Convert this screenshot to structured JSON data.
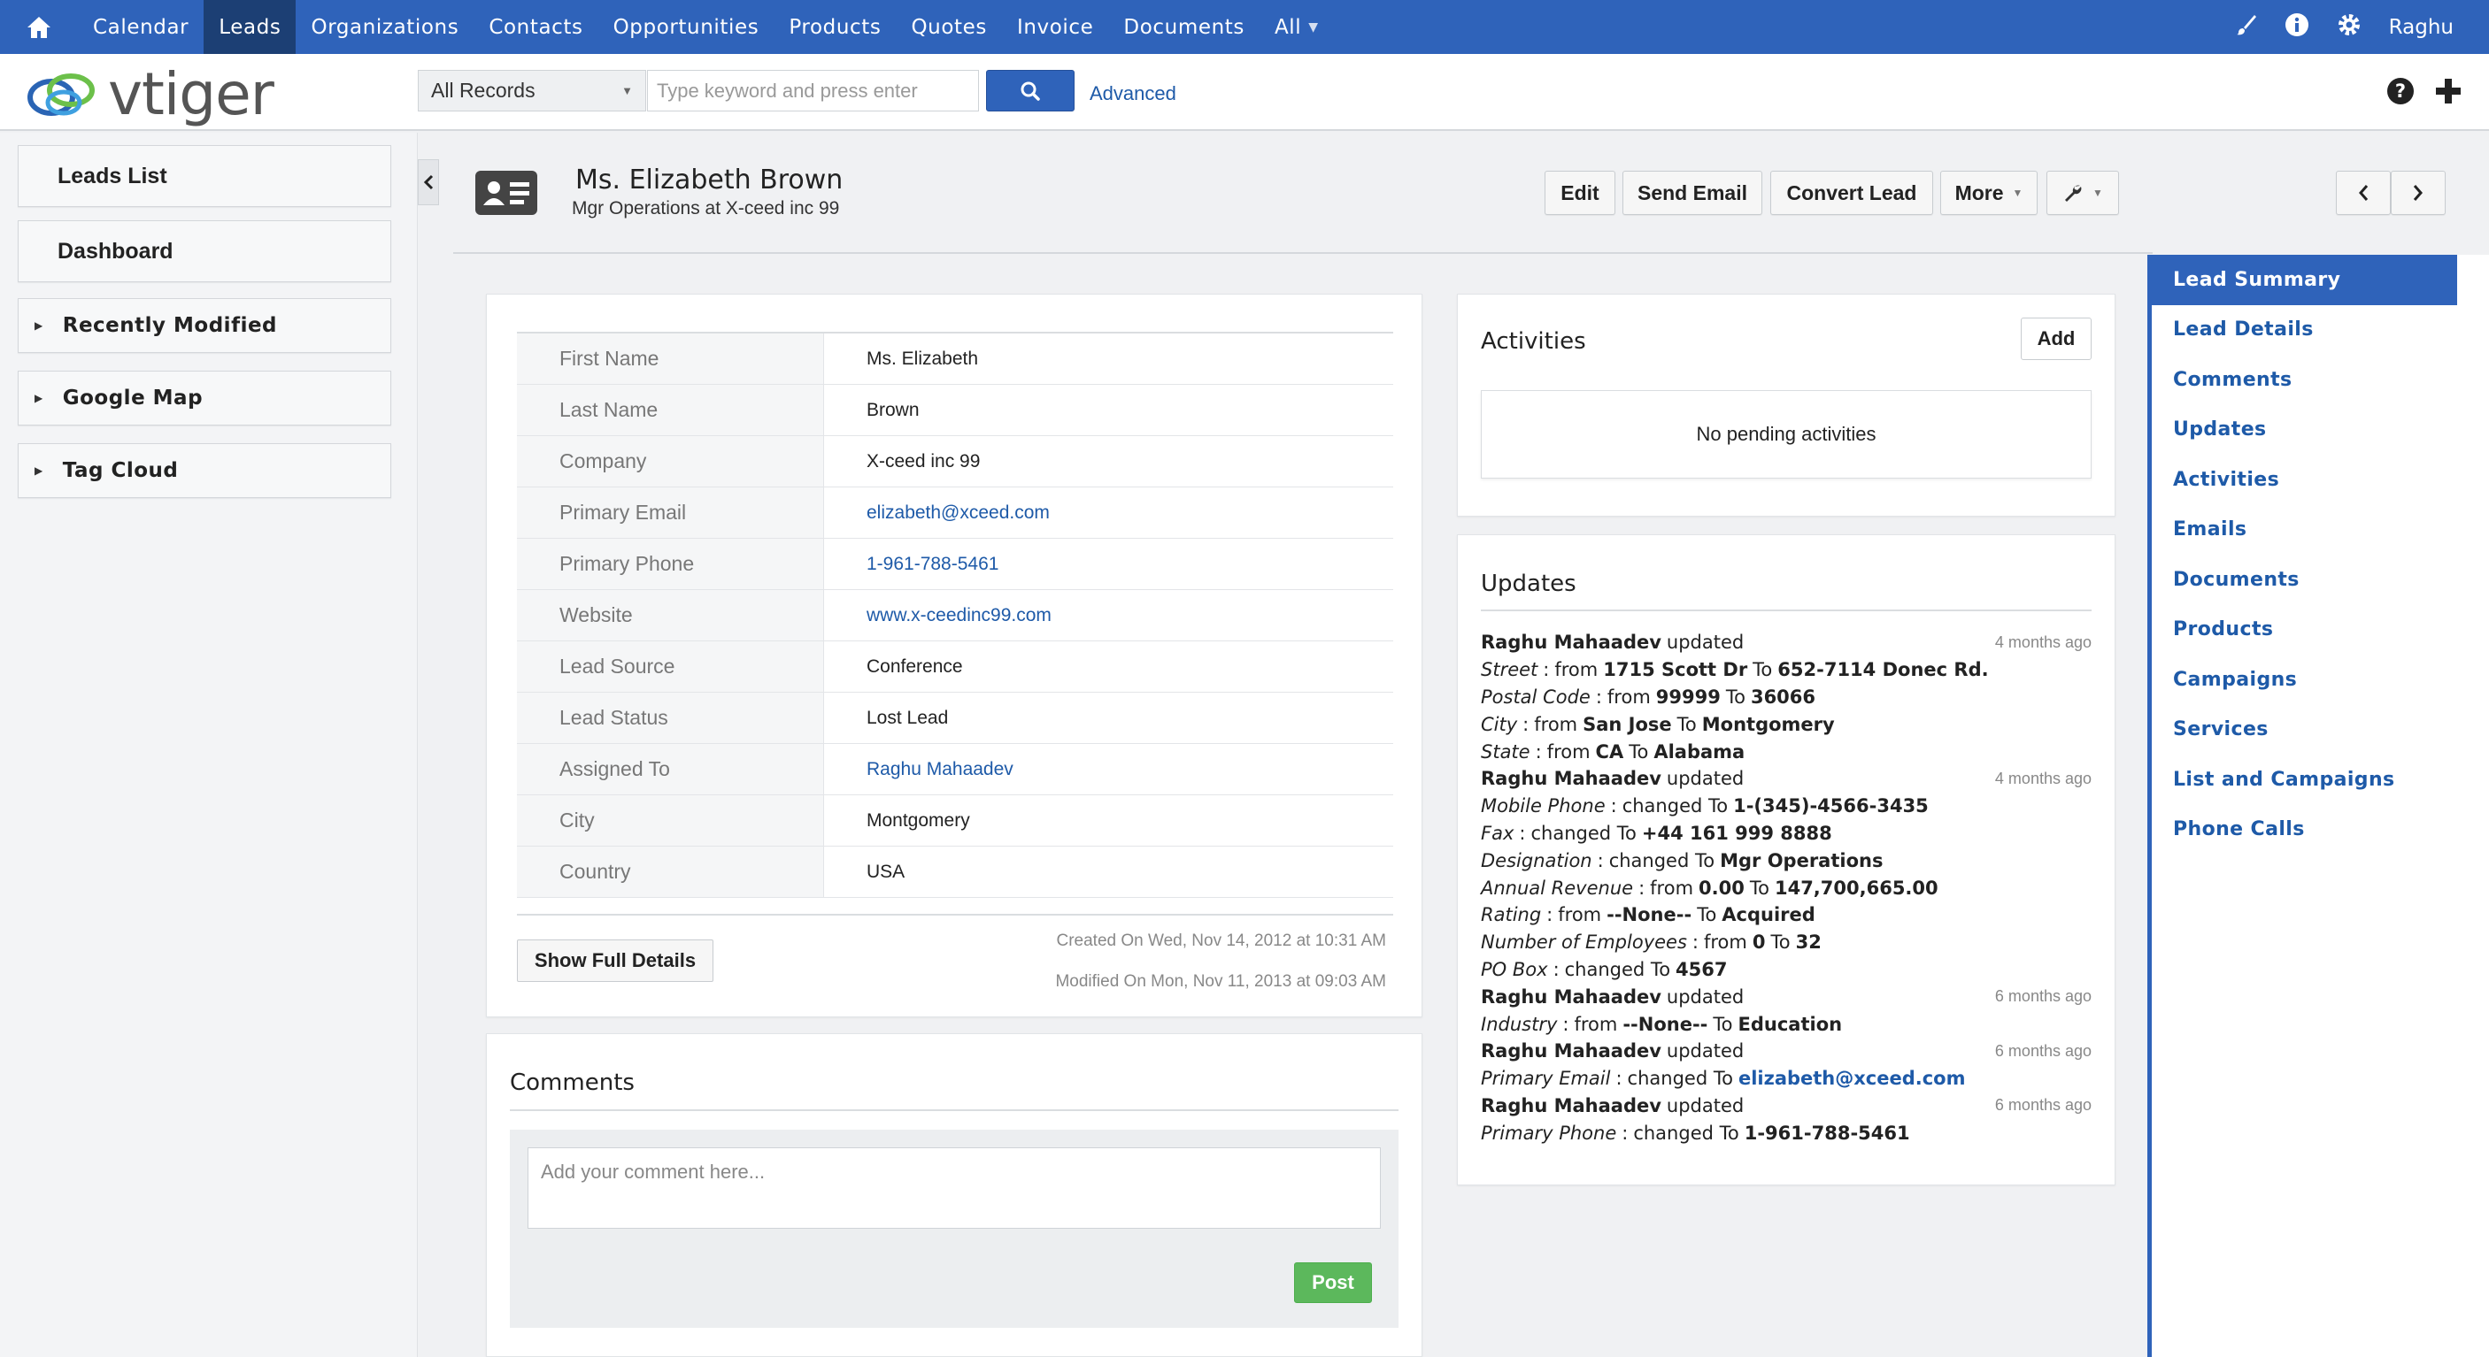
{
  "topnav": {
    "items": [
      "Calendar",
      "Leads",
      "Organizations",
      "Contacts",
      "Opportunities",
      "Products",
      "Quotes",
      "Invoice",
      "Documents",
      "All"
    ],
    "active": "Leads",
    "user": "Raghu",
    "icons": [
      "home-icon",
      "brush-icon",
      "info-icon",
      "gear-icon"
    ],
    "accent_color": "#2f63ba"
  },
  "header": {
    "logo_text": "vtiger",
    "record_filter": "All Records",
    "search_placeholder": "Type keyword and press enter",
    "advanced_label": "Advanced"
  },
  "sidebar": {
    "leads_list": "Leads List",
    "dashboard": "Dashboard",
    "widgets": [
      "Recently Modified",
      "Google Map",
      "Tag Cloud"
    ]
  },
  "record": {
    "name": "Ms. Elizabeth Brown",
    "subtitle": "Mgr Operations at X-ceed inc 99",
    "buttons": {
      "edit": "Edit",
      "send_email": "Send Email",
      "convert": "Convert Lead",
      "more": "More"
    }
  },
  "summary": {
    "fields": [
      {
        "label": "First Name",
        "value": "Ms. Elizabeth",
        "link": false
      },
      {
        "label": "Last Name",
        "value": "Brown",
        "link": false
      },
      {
        "label": "Company",
        "value": "X-ceed inc 99",
        "link": false
      },
      {
        "label": "Primary Email",
        "value": "elizabeth@xceed.com",
        "link": true
      },
      {
        "label": "Primary Phone",
        "value": "1-961-788-5461",
        "link": true
      },
      {
        "label": "Website",
        "value": "www.x-ceedinc99.com",
        "link": true
      },
      {
        "label": "Lead Source",
        "value": "Conference",
        "link": false
      },
      {
        "label": "Lead Status",
        "value": "Lost Lead",
        "link": false
      },
      {
        "label": "Assigned To",
        "value": "Raghu Mahaadev",
        "link": true
      },
      {
        "label": "City",
        "value": "Montgomery",
        "link": false
      },
      {
        "label": "Country",
        "value": "USA",
        "link": false
      }
    ],
    "show_full": "Show Full Details",
    "created_on": "Created On Wed, Nov 14, 2012 at 10:31 AM",
    "modified_on": "Modified On Mon, Nov 11, 2013 at 09:03 AM"
  },
  "comments": {
    "title": "Comments",
    "placeholder": "Add your comment here...",
    "post": "Post"
  },
  "activities": {
    "title": "Activities",
    "add": "Add",
    "empty": "No pending activities"
  },
  "updates": {
    "title": "Updates",
    "lines": [
      {
        "kind": "head",
        "who": "Raghu Mahaadev",
        "text": "updated",
        "ago": "4 months ago"
      },
      {
        "kind": "change",
        "field": "Street",
        "verb": "from",
        "old": "1715 Scott Dr",
        "to": "To",
        "new": "652-7114 Donec Rd."
      },
      {
        "kind": "change",
        "field": "Postal Code",
        "verb": "from",
        "old": "99999",
        "to": "To",
        "new": "36066"
      },
      {
        "kind": "change",
        "field": "City",
        "verb": "from",
        "old": "San Jose",
        "to": "To",
        "new": "Montgomery"
      },
      {
        "kind": "change",
        "field": "State",
        "verb": "from",
        "old": "CA",
        "to": "To",
        "new": "Alabama"
      },
      {
        "kind": "head",
        "who": "Raghu Mahaadev",
        "text": "updated",
        "ago": "4 months ago"
      },
      {
        "kind": "change",
        "field": "Mobile Phone",
        "verb": "changed To",
        "new": "1-(345)-4566-3435"
      },
      {
        "kind": "change",
        "field": "Fax",
        "verb": "changed To",
        "new": "+44 161 999 8888"
      },
      {
        "kind": "change",
        "field": "Designation",
        "verb": "changed To",
        "new": "Mgr Operations"
      },
      {
        "kind": "change",
        "field": "Annual Revenue",
        "verb": "from",
        "old": "0.00",
        "to": "To",
        "new": "147,700,665.00"
      },
      {
        "kind": "change",
        "field": "Rating",
        "verb": "from",
        "old": "--None--",
        "to": "To",
        "new": "Acquired"
      },
      {
        "kind": "change",
        "field": "Number of Employees",
        "verb": "from",
        "old": "0",
        "to": "To",
        "new": "32"
      },
      {
        "kind": "change",
        "field": "PO Box",
        "verb": "changed To",
        "new": "4567"
      },
      {
        "kind": "head",
        "who": "Raghu Mahaadev",
        "text": "updated",
        "ago": "6 months ago"
      },
      {
        "kind": "change",
        "field": "Industry",
        "verb": "from",
        "old": "--None--",
        "to": "To",
        "new": "Education"
      },
      {
        "kind": "head",
        "who": "Raghu Mahaadev",
        "text": "updated",
        "ago": "6 months ago"
      },
      {
        "kind": "change",
        "field": "Primary Email",
        "verb": "changed To",
        "new": "elizabeth@xceed.com",
        "link": true
      },
      {
        "kind": "head",
        "who": "Raghu Mahaadev",
        "text": "updated",
        "ago": "6 months ago"
      },
      {
        "kind": "change",
        "field": "Primary Phone",
        "verb": "changed To",
        "new": "1-961-788-5461"
      }
    ]
  },
  "related": {
    "items": [
      "Lead Summary",
      "Lead Details",
      "Comments",
      "Updates",
      "Activities",
      "Emails",
      "Documents",
      "Products",
      "Campaigns",
      "Services",
      "List and Campaigns",
      "Phone Calls"
    ],
    "active": "Lead Summary"
  }
}
